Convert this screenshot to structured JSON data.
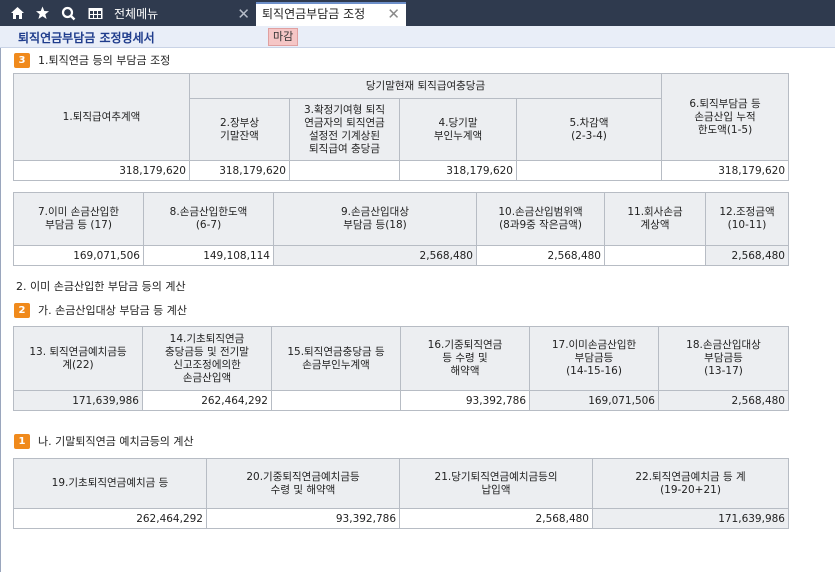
{
  "tabs": {
    "menu_label": "전체메뉴",
    "active_label": "퇴직연금부담금 조정"
  },
  "titlebar": {
    "title": "퇴직연금부담금  조정명세서",
    "badge": "마감"
  },
  "section1": {
    "badge": "3",
    "title": "1.퇴직연금 등의 부담금 조정",
    "group_header": "당기말현재 퇴직급여충당금",
    "headers": {
      "c1": "1.퇴직급여추계액",
      "c2": "2.장부상\n기말잔액",
      "c3": "3.확정기여형 퇴직\n연금자의 퇴직연금\n설정전 기계상된\n퇴직급여 충당금",
      "c4": "4.당기말\n부인누계액",
      "c5": "5.차감액\n(2-3-4)",
      "c6": "6.퇴직부담금 등\n손금산입 누적\n한도액(1-5)"
    },
    "values": {
      "c1": "318,179,620",
      "c2": "318,179,620",
      "c3": "",
      "c4": "318,179,620",
      "c5": "",
      "c6": "318,179,620"
    }
  },
  "table2": {
    "headers": {
      "c7": "7.이미 손금산입한\n부담금 등 (17)",
      "c8": "8.손금산입한도액\n(6-7)",
      "c9": "9.손금산입대상\n부담금 등(18)",
      "c10": "10.손금산입범위액\n(8과9중 작은금액)",
      "c11": "11.회사손금\n계상액",
      "c12": "12.조정금액\n(10-11)"
    },
    "values": {
      "c7": "169,071,506",
      "c8": "149,108,114",
      "c9": "2,568,480",
      "c10": "2,568,480",
      "c11": "",
      "c12": "2,568,480"
    }
  },
  "section2": {
    "title": "2. 이미 손금산입한 부담금 등의 계산",
    "sub_badge": "2",
    "sub_title": "가. 손금산입대상 부담금 등 계산",
    "headers": {
      "c13": "13. 퇴직연금예치금등\n계(22)",
      "c14": "14.기초퇴직연금\n충당금등 및 전기말\n신고조정에의한\n손금산입액",
      "c15": "15.퇴직연금충당금 등\n손금부인누계액",
      "c16": "16.기중퇴직연금\n등 수령 및\n해약액",
      "c17": "17.이미손금산입한\n부담금등\n(14-15-16)",
      "c18": "18.손금산입대상\n부담금등\n(13-17)"
    },
    "values": {
      "c13": "171,639,986",
      "c14": "262,464,292",
      "c15": "",
      "c16": "93,392,786",
      "c17": "169,071,506",
      "c18": "2,568,480"
    }
  },
  "section3": {
    "badge": "1",
    "title": "나. 기말퇴직연금 예치금등의 계산",
    "headers": {
      "c19": "19.기초퇴직연금예치금 등",
      "c20": "20.기중퇴직연금예치금등\n수령 및 해약액",
      "c21": "21.당기퇴직연금예치금등의\n납입액",
      "c22": "22.퇴직연금예치금 등 계\n(19-20+21)"
    },
    "values": {
      "c19": "262,464,292",
      "c20": "93,392,786",
      "c21": "2,568,480",
      "c22": "171,639,986"
    }
  },
  "colors": {
    "topbar": "#2f3a4e",
    "title_text": "#1f3c8c",
    "badge_orange": "#f08a1c",
    "header_bg": "#eceef1"
  },
  "icons": [
    "home-icon",
    "star-icon",
    "search-icon",
    "grid-menu-icon"
  ]
}
